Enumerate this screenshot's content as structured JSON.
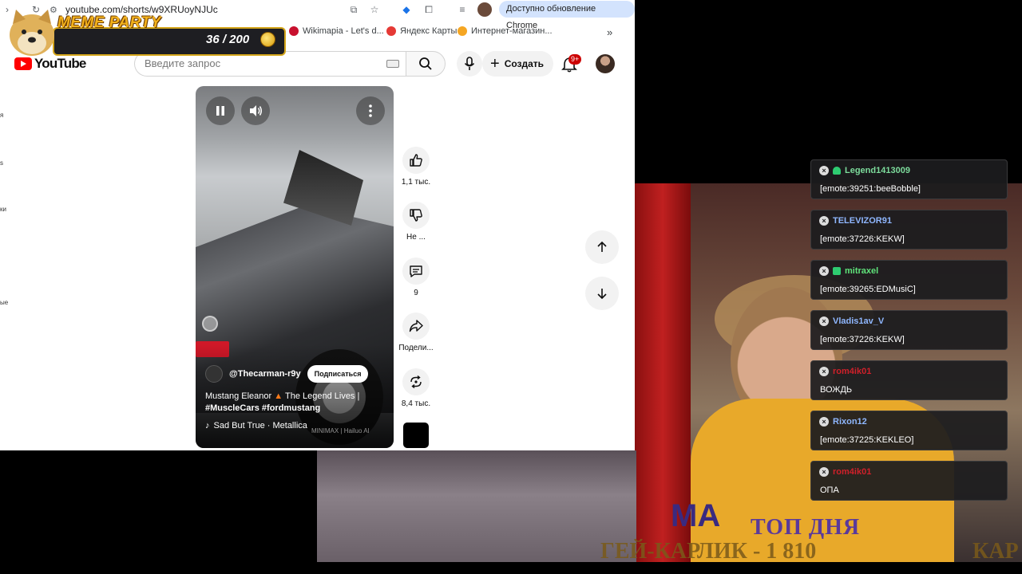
{
  "browser": {
    "url": "youtube.com/shorts/w9XRUoyNJUc",
    "update_label": "Доступно обновление Chrome",
    "bookmarks": [
      {
        "label": "Wikimapia - Let's d...",
        "icon_color": "#c8102e"
      },
      {
        "label": "Яндекс Карты",
        "icon_color": "#e53935"
      },
      {
        "label": "Интернет-магазин...",
        "icon_color": "#f5a623"
      }
    ],
    "bookmarks_overflow": "»"
  },
  "meme_overlay": {
    "title": "MEME PARTY",
    "count": "36 / 200"
  },
  "youtube": {
    "logo_text": "YouTube",
    "search_placeholder": "Введите запрос",
    "create_label": "Создать",
    "notification_badge": "9+"
  },
  "short": {
    "channel": "@Thecarman-r9y",
    "subscribe_label": "Подписаться",
    "title_part1": "Mustang Eleanor",
    "title_part2": "The Legend Lives |",
    "hashtags": "#MuscleCars #fordmustang",
    "music": "Sad But True · Metallica",
    "watermark": "MINIMAX | Hailuo AI"
  },
  "actions": {
    "likes": "1,1 тыс.",
    "dislike_label": "Не ...",
    "comments": "9",
    "share_label": "Подели...",
    "remix_count": "8,4 тыс."
  },
  "stream": {
    "top_day_label": "ТОП ДНЯ",
    "top_user": "ГЕЙ-КАРЛИК - 1 810",
    "top_right_fragment": "КАР",
    "shirt_text": "MA"
  },
  "chat": [
    {
      "name": "Legend1413009",
      "color": "#7ddc9c",
      "badge": "heart",
      "text": "[emote:39251:beeBobble]"
    },
    {
      "name": "TELEVIZOR91",
      "color": "#8fb7ff",
      "badge": "",
      "text": "[emote:37226:KEKW]"
    },
    {
      "name": "mitraxel",
      "color": "#5fe37a",
      "badge": "square",
      "text": "[emote:39265:EDMusiC]"
    },
    {
      "name": "Vladis1av_V",
      "color": "#8fb7ff",
      "badge": "",
      "text": "[emote:37226:KEKW]"
    },
    {
      "name": "rom4ik01",
      "color": "#d0202a",
      "badge": "",
      "text": "ВОЖДЬ"
    },
    {
      "name": "Rixon12",
      "color": "#8fb7ff",
      "badge": "",
      "text": "[emote:37225:KEKLEO]"
    },
    {
      "name": "rom4ik01",
      "color": "#d0202a",
      "badge": "",
      "text": "ОПА"
    }
  ]
}
